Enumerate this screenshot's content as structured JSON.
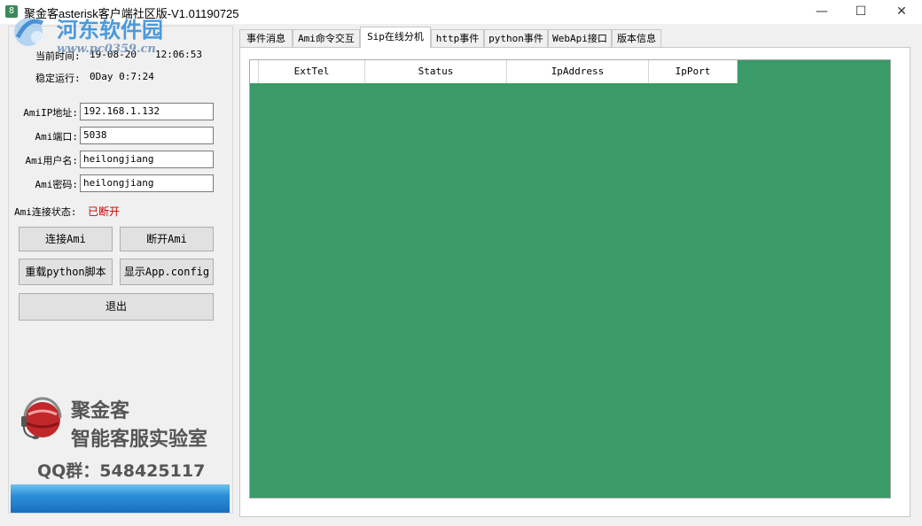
{
  "window": {
    "title": "聚金客asterisk客户端社区版-V1.01190725",
    "minimize": "—",
    "maximize": "☐",
    "close": "✕"
  },
  "watermark": {
    "title": "河东软件园",
    "url": "www.pc0359.cn"
  },
  "left": {
    "current_time_label": "当前时间:",
    "current_date": "19-08-20",
    "current_clock": "12:06:53",
    "uptime_label": "稳定运行:",
    "uptime_value": "0Day 0:7:24",
    "ami_ip_label": "AmiIP地址:",
    "ami_ip_value": "192.168.1.132",
    "ami_port_label": "Ami端口:",
    "ami_port_value": "5038",
    "ami_user_label": "Ami用户名:",
    "ami_user_value": "heilongjiang",
    "ami_pass_label": "Ami密码:",
    "ami_pass_value": "heilongjiang",
    "conn_status_label": "Ami连接状态:",
    "conn_status_value": "已断开",
    "conn_status_color": "#d00000",
    "btn_connect": "连接Ami",
    "btn_disconnect": "断开Ami",
    "btn_reload": "重载python脚本",
    "btn_show_config": "显示App.config",
    "btn_exit": "退出"
  },
  "brand": {
    "line1": "聚金客",
    "line2": "智能客服实验室",
    "qq": "QQ群：548425117"
  },
  "tabs": [
    {
      "label": "事件消息"
    },
    {
      "label": "Ami命令交互"
    },
    {
      "label": "Sip在线分机"
    },
    {
      "label": "http事件"
    },
    {
      "label": "python事件"
    },
    {
      "label": "WebApi接口"
    },
    {
      "label": "版本信息"
    }
  ],
  "active_tab": "Sip在线分机",
  "grid": {
    "background": "#3a9a68",
    "columns": [
      "ExtTel",
      "Status",
      "IpAddress",
      "IpPort"
    ]
  }
}
